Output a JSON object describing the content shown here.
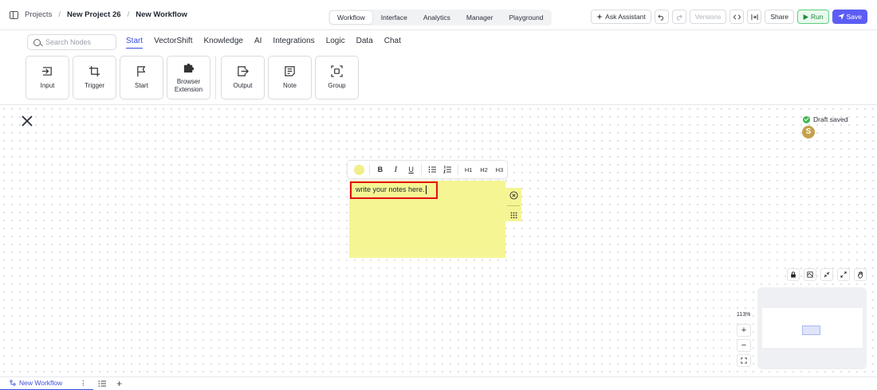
{
  "breadcrumb": {
    "root": "Projects",
    "project": "New Project 26",
    "workflow": "New Workflow"
  },
  "mode_tabs": [
    "Workflow",
    "Interface",
    "Analytics",
    "Manager",
    "Playground"
  ],
  "header_actions": {
    "ask": "Ask Assistant",
    "versions": "Versions",
    "share": "Share",
    "run": "Run",
    "save": "Save"
  },
  "search": {
    "placeholder": "Search Nodes"
  },
  "categories": [
    "Start",
    "VectorShift",
    "Knowledge",
    "AI",
    "Integrations",
    "Logic",
    "Data",
    "Chat"
  ],
  "nodes": [
    {
      "label": "Input",
      "icon": "input-icon"
    },
    {
      "label": "Trigger",
      "icon": "crop-icon"
    },
    {
      "label": "Start",
      "icon": "flag-icon"
    },
    {
      "label": "Browser Extension",
      "icon": "puzzle-icon"
    },
    {
      "label": "Output",
      "icon": "output-icon"
    },
    {
      "label": "Note",
      "icon": "note-icon"
    },
    {
      "label": "Group",
      "icon": "group-icon"
    }
  ],
  "status": {
    "draft": "Draft saved",
    "avatar_initial": "S"
  },
  "note": {
    "text": "write your notes here.",
    "color": "#f5f594",
    "toolbar": {
      "bold": "B",
      "italic": "I",
      "underline": "U",
      "h1": "H1",
      "h2": "H2",
      "h3": "H3"
    }
  },
  "zoom": {
    "label": "113%",
    "plus": "+",
    "minus": "−"
  },
  "bottom": {
    "tab": "New Workflow",
    "add": "+"
  },
  "colors": {
    "accent": "#3b4fe0",
    "save": "#5b5df5",
    "run": "#1e8a3e",
    "highlight": "#e01010"
  }
}
